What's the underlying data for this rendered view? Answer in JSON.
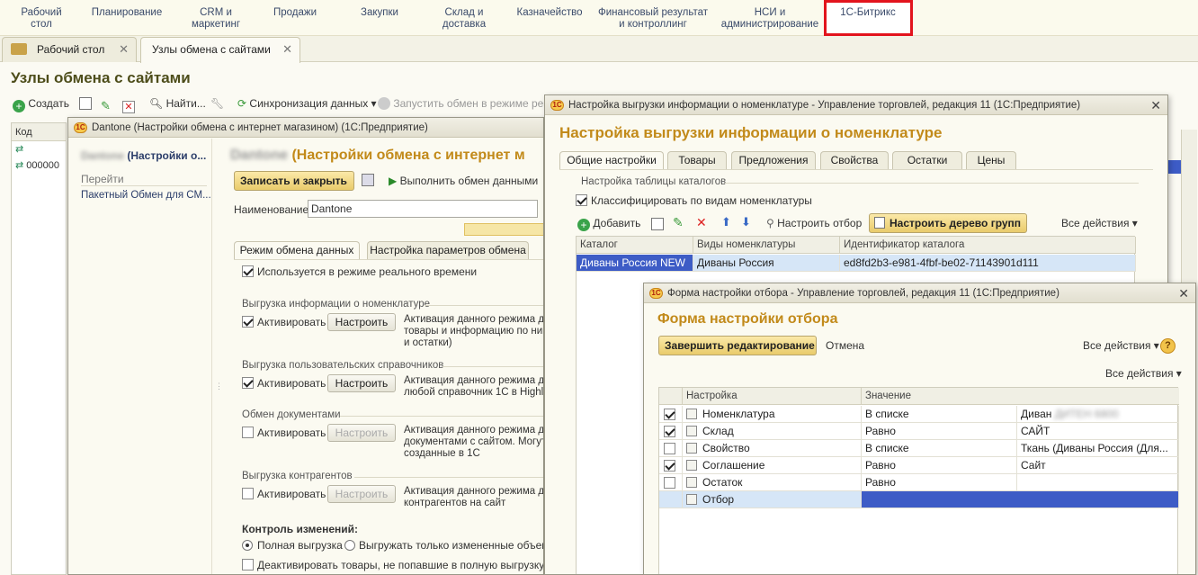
{
  "top_menu": {
    "items": [
      {
        "label": "Рабочий\nстол"
      },
      {
        "label": "Планирование"
      },
      {
        "label": "CRM и\nмаркетинг"
      },
      {
        "label": "Продажи"
      },
      {
        "label": "Закупки"
      },
      {
        "label": "Склад и\nдоставка"
      },
      {
        "label": "Казначейство"
      },
      {
        "label": "Финансовый результат\nи контроллинг"
      },
      {
        "label": "НСИ и\nадминистрирование"
      },
      {
        "label": "1С-Битрикс"
      }
    ],
    "highlight_color": "#e2141d"
  },
  "tabs": [
    {
      "label": "Рабочий стол"
    },
    {
      "label": "Узлы обмена с сайтами"
    }
  ],
  "page": {
    "title": "Узлы обмена с сайтами",
    "toolbar": {
      "create": "Создать",
      "find": "Найти...",
      "sync": "Синхронизация данных",
      "run": "Запустить обмен в режиме реа"
    },
    "list": {
      "col_code": "Код",
      "row2": "000000"
    }
  },
  "win_dantone": {
    "title": "Dantone (Настройки обмена с интернет магазином) (1С:Предприятие)",
    "header": "(Настройки обмена с интернет м",
    "blurred_name": "Dantone",
    "nav_title": "(Настройки о...",
    "nav_go": "Перейти",
    "nav_link": "Пакетный Обмен для СМ...",
    "save_close": "Записать и закрыть",
    "run_exchange": "Выполнить обмен данными",
    "name_label": "Наименование:",
    "name_value": "Dantone",
    "tab1": "Режим обмена данных",
    "tab2": "Настройка параметров обмена",
    "realtime": "Используется в режиме  реального времени",
    "g1_title": "Выгрузка информации о номенклатуре",
    "g1_check": "Активировать",
    "g1_btn": "Настроить",
    "g1_desc": "Активация данного режима да\nтовары и информацию по ним\nи остатки)",
    "g2_title": "Выгрузка пользовательских справочников",
    "g2_check": "Активировать",
    "g2_btn": "Настроить",
    "g2_desc": "Активация данного режима да\nлюбой справочник 1С в Highloa",
    "g3_title": "Обмен документами",
    "g3_check": "Активировать",
    "g3_btn": "Настроить",
    "g3_desc": "Активация данного режима да\nдокументами с сайтом. Могут\nсозданные в 1С",
    "g4_title": "Выгрузка контрагентов",
    "g4_check": "Активировать",
    "g4_btn": "Настроить",
    "g4_desc": "Активация данного режима да\nконтрагентов на сайт",
    "ctrl_title": "Контроль изменений:",
    "radio_full": "Полная выгрузка",
    "radio_changed": "Выгружать только измененные объекты",
    "deactivate": "Деактивировать товары, не попавшие в полную выгрузку"
  },
  "win_nomen": {
    "title": "Настройка выгрузки информации о номенклатуре - Управление торговлей, редакция 11  (1С:Предприятие)",
    "header": "Настройка выгрузки информации о номенклатуре",
    "tabs": [
      "Общие настройки",
      "Товары",
      "Предложения",
      "Свойства",
      "Остатки",
      "Цены"
    ],
    "group_title": "Настройка таблицы каталогов",
    "classify": "Классифицировать по видам номенклатуры",
    "add": "Добавить",
    "filter": "Настроить отбор",
    "tree": "Настроить дерево групп",
    "all_actions": "Все действия",
    "columns": [
      "Каталог",
      "Виды номенклатуры",
      "Идентификатор каталога"
    ],
    "rows": [
      [
        "Диваны Россия NEW",
        "Диваны Россия",
        "ed8fd2b3-e981-4fbf-be02-71143901d111"
      ]
    ]
  },
  "win_filter": {
    "title": "Форма настройки отбора - Управление торговлей, редакция 11  (1С:Предприятие)",
    "header": "Форма настройки отбора",
    "finish": "Завершить редактирование",
    "cancel": "Отмена",
    "all_actions": "Все действия",
    "all_actions2": "Все действия",
    "col_setting": "Настройка",
    "col_value": "Значение",
    "rows": [
      {
        "checked": true,
        "name": "Номенклатура",
        "cond": "В списке",
        "value": "Диван",
        "blur": "ДИТЕН 6800"
      },
      {
        "checked": true,
        "name": "Склад",
        "cond": "Равно",
        "value": "САЙТ",
        "blur": ""
      },
      {
        "checked": false,
        "name": "Свойство",
        "cond": "В списке",
        "value": "Ткань (Диваны Россия (Для...",
        "blur": ""
      },
      {
        "checked": true,
        "name": "Соглашение",
        "cond": "Равно",
        "value": "Сайт",
        "blur": ""
      },
      {
        "checked": false,
        "name": "Остаток",
        "cond": "Равно",
        "value": "",
        "blur": ""
      },
      {
        "checked": null,
        "name": "Отбор",
        "cond": "",
        "value": "",
        "blur": ""
      }
    ]
  }
}
